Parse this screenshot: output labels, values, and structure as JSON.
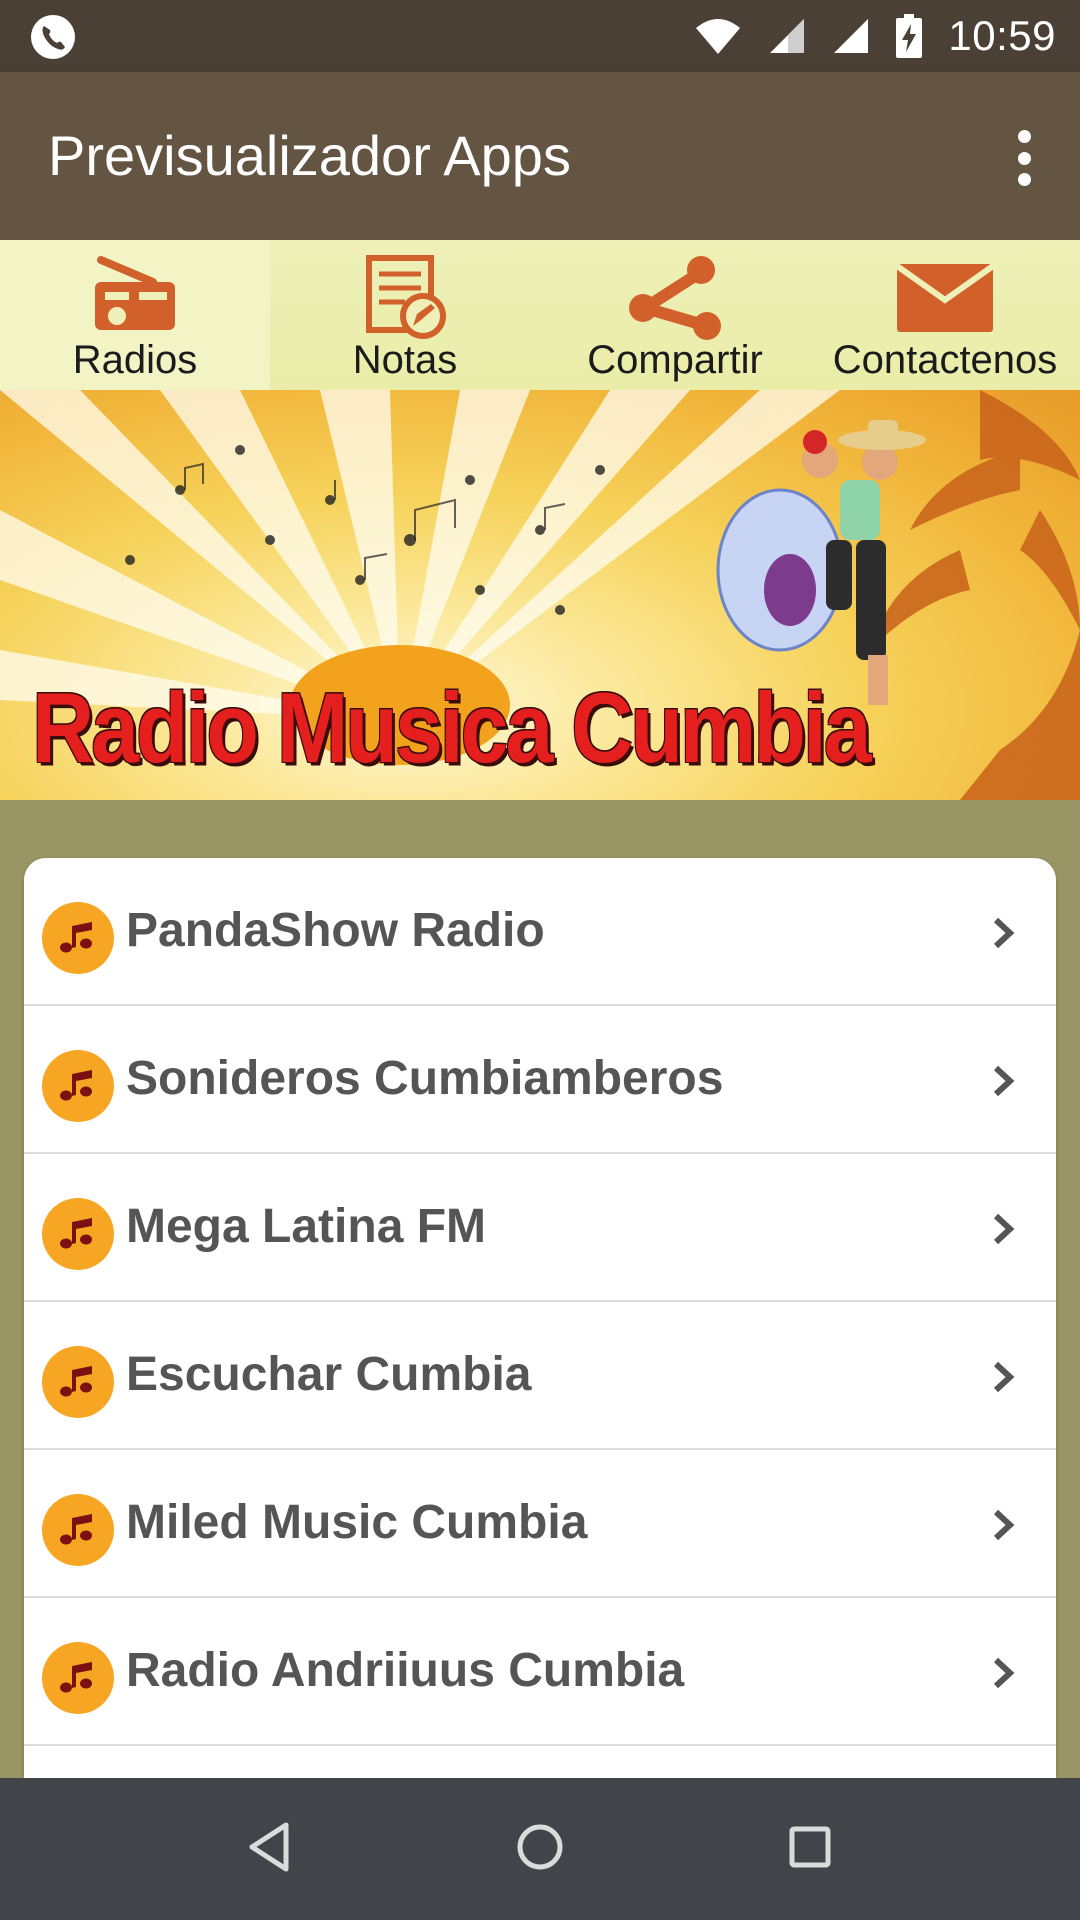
{
  "status_bar": {
    "time": "10:59",
    "icons": [
      "phone-call-icon",
      "wifi-icon",
      "signal-icon",
      "signal-icon",
      "battery-charging-icon"
    ]
  },
  "app_bar": {
    "title": "Previsualizador Apps",
    "menu_icon": "more-vert-icon"
  },
  "tabs": [
    {
      "label": "Radios",
      "icon": "radio-icon",
      "active": true
    },
    {
      "label": "Notas",
      "icon": "notes-icon",
      "active": false
    },
    {
      "label": "Compartir",
      "icon": "share-icon",
      "active": false
    },
    {
      "label": "Contactenos",
      "icon": "mail-icon",
      "active": false
    }
  ],
  "banner": {
    "text": "Radio Musica Cumbia"
  },
  "stations": [
    {
      "name": "PandaShow Radio"
    },
    {
      "name": "Sonideros Cumbiamberos"
    },
    {
      "name": "Mega Latina FM"
    },
    {
      "name": "Escuchar Cumbia"
    },
    {
      "name": "Miled Music Cumbia"
    },
    {
      "name": "Radio Andriiuus Cumbia"
    }
  ],
  "nav_bar": {
    "icons": [
      "back-icon",
      "home-icon",
      "recents-icon"
    ]
  },
  "colors": {
    "status_bar": "#4b4035",
    "app_bar": "#645442",
    "tab_bar": "#eaeda8",
    "tab_icon": "#d2602a",
    "background": "#9a9565",
    "badge": "#f6a623",
    "note": "#7a1010",
    "nav_bar": "#414549"
  }
}
